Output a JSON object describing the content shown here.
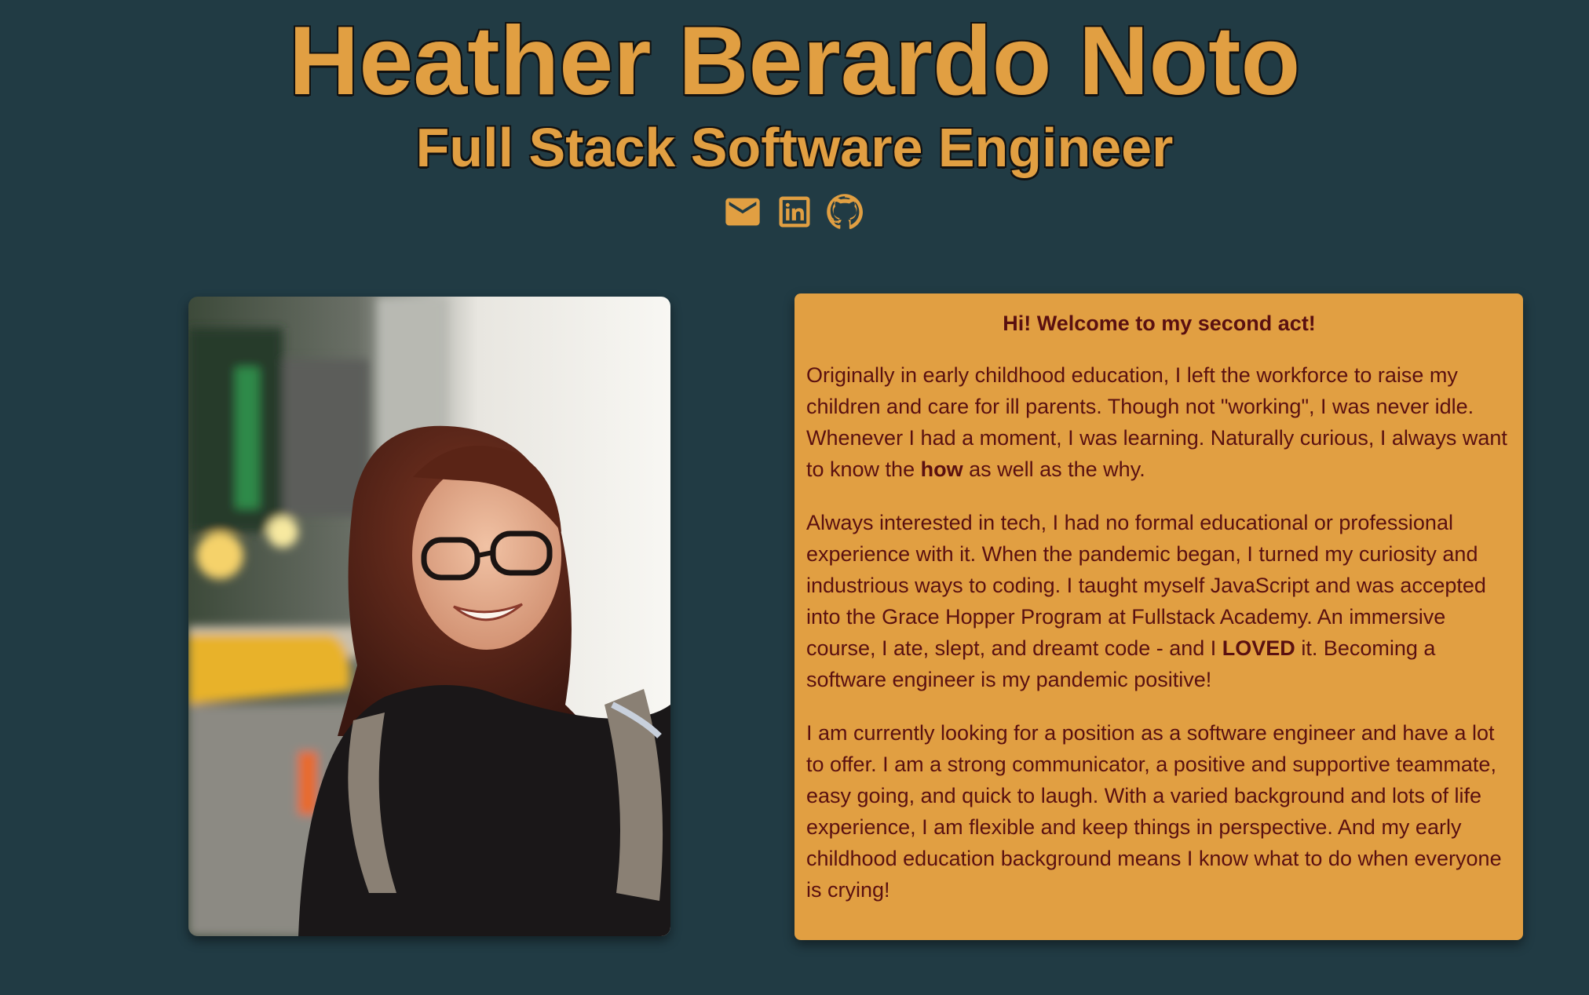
{
  "header": {
    "name": "Heather Berardo Noto",
    "role": "Full Stack Software Engineer"
  },
  "social": [
    {
      "icon": "email-icon",
      "label": "Email"
    },
    {
      "icon": "linkedin-icon",
      "label": "LinkedIn"
    },
    {
      "icon": "github-icon",
      "label": "GitHub"
    }
  ],
  "photo": {
    "alt": "Portrait of Heather smiling in Times Square at night"
  },
  "about": {
    "title": "Hi! Welcome to my second act!",
    "p1_a": "Originally in early childhood education, I left the workforce to raise my children and care for ill parents. Though not \"working\", I was never idle. Whenever I had a moment, I was learning. Naturally curious, I always want to know the ",
    "p1_b": "how",
    "p1_c": " as well as the why.",
    "p2_a": "Always interested in tech, I had no formal educational or professional experience with it. When the pandemic began, I turned my curiosity and industrious ways to coding. I taught myself JavaScript and was accepted into the Grace Hopper Program at Fullstack Academy. An immersive course, I ate, slept, and dreamt code - and I ",
    "p2_b": "LOVED",
    "p2_c": " it. Becoming a software engineer is my pandemic positive!",
    "p3": "I am currently looking for a position as a software engineer and have a lot to offer. I am a strong communicator, a positive and supportive teammate, easy going, and quick to laugh. With a varied background and lots of life experience, I am flexible and keep things in perspective. And my early childhood education background means I know what to do when everyone is crying!"
  },
  "colors": {
    "background": "#213b44",
    "accent": "#e19f42",
    "text_dark": "#5a1010"
  }
}
